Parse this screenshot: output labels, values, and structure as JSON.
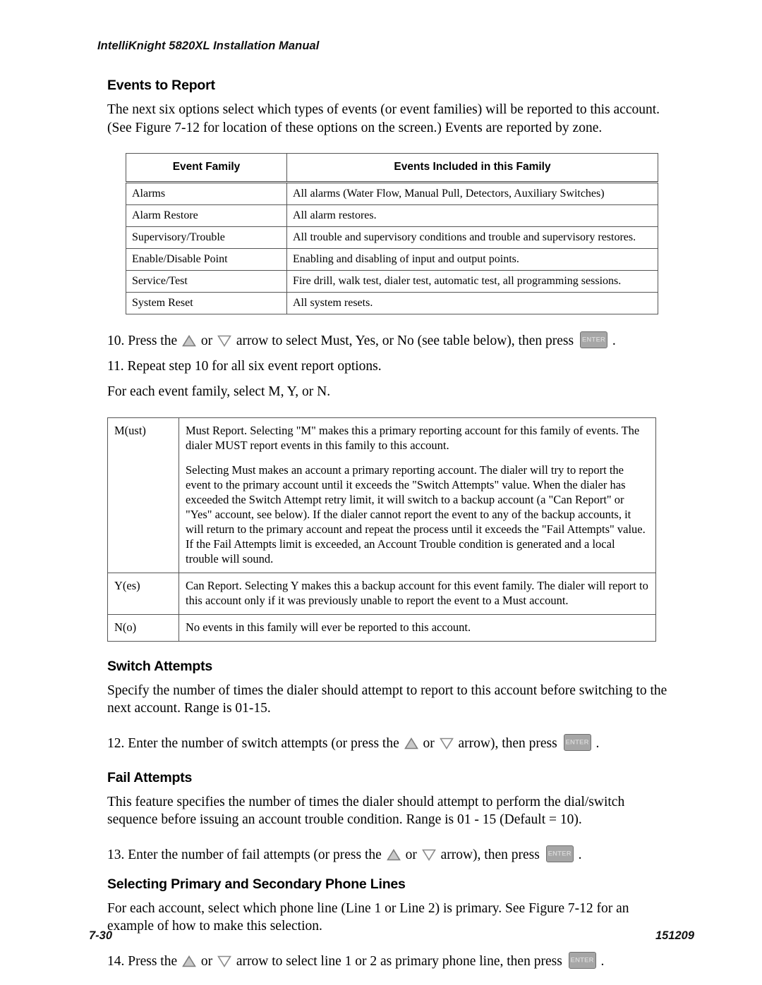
{
  "header": {
    "running_title": "IntelliKnight 5820XL Installation Manual"
  },
  "footer": {
    "page_number": "7-30",
    "document_number": "151209"
  },
  "icons": {
    "up_arrow": "up-triangle-icon",
    "down_arrow": "down-triangle-icon",
    "enter_key_label": "ENTER"
  },
  "sections": {
    "events_to_report": {
      "heading": "Events to Report",
      "intro": "The next six options select which types of events (or event families) will be reported to this account. (See Figure 7-12 for location of these options on the screen.) Events are reported by zone.",
      "table": {
        "headers": [
          "Event Family",
          "Events Included in this Family"
        ],
        "rows": [
          [
            "Alarms",
            "All alarms (Water Flow, Manual Pull, Detectors, Auxiliary Switches)"
          ],
          [
            "Alarm Restore",
            "All alarm restores."
          ],
          [
            "Supervisory/Trouble",
            "All trouble and supervisory conditions and trouble and supervisory restores."
          ],
          [
            "Enable/Disable Point",
            "Enabling and disabling of input and output points."
          ],
          [
            "Service/Test",
            "Fire drill, walk test, dialer test, automatic test, all programming sessions."
          ],
          [
            "System Reset",
            "All system resets."
          ]
        ]
      },
      "step10_a": "10. Press the",
      "step10_b": "or",
      "step10_c": "arrow to select Must, Yes, or No (see table below), then press",
      "step10_d": ".",
      "step11": "11. Repeat step 10 for all six event report options.",
      "select_note": "For each event family, select M, Y, or N."
    },
    "myn_table": {
      "rows": [
        {
          "key": "M(ust)",
          "paragraphs": [
            "Must Report. Selecting \"M\" makes this a primary reporting account for this family of events. The dialer MUST report events in this family to this account.",
            "Selecting Must makes an account a primary reporting account. The dialer will try to report the event to the primary account until it exceeds the \"Switch Attempts\" value.  When the dialer has exceeded the Switch Attempt retry limit, it will switch to a backup account (a \"Can Report\" or \"Yes\" account, see below). If the dialer cannot report the event to any of the backup accounts, it will return to the primary account and repeat the process until it exceeds the \"Fail Attempts\" value. If the Fail Attempts limit is exceeded, an Account Trouble condition is generated and a local trouble will sound."
          ]
        },
        {
          "key": "Y(es)",
          "paragraphs": [
            "Can Report. Selecting Y makes this a backup account for this event family. The dialer will report to this account only if it was previously unable to report the event to a Must account."
          ]
        },
        {
          "key": "N(o)",
          "paragraphs": [
            "No events in this family will ever be reported to this account."
          ]
        }
      ]
    },
    "switch_attempts": {
      "heading": "Switch Attempts",
      "body": "Specify the number of times the dialer should attempt to report to this account before switching to the next account. Range is 01-15.",
      "step12_a": "12. Enter the number of switch attempts (or press the",
      "step12_b": "or",
      "step12_c": "arrow), then press",
      "step12_d": "."
    },
    "fail_attempts": {
      "heading": "Fail Attempts",
      "body": "This feature specifies the number of times the dialer should attempt to perform the dial/switch sequence before issuing an account trouble condition. Range is 01 - 15 (Default = 10).",
      "step13_a": "13. Enter the number of fail attempts (or press the",
      "step13_b": "or",
      "step13_c": "arrow), then press",
      "step13_d": "."
    },
    "phone_lines": {
      "heading": "Selecting Primary and Secondary Phone Lines",
      "body": "For each account, select which phone line (Line 1 or Line 2) is primary. See Figure 7-12 for an example of how to make this selection.",
      "step14_a": "14. Press the",
      "step14_b": "or",
      "step14_c": "arrow to select line 1 or 2 as primary phone line, then press",
      "step14_d": "."
    }
  }
}
